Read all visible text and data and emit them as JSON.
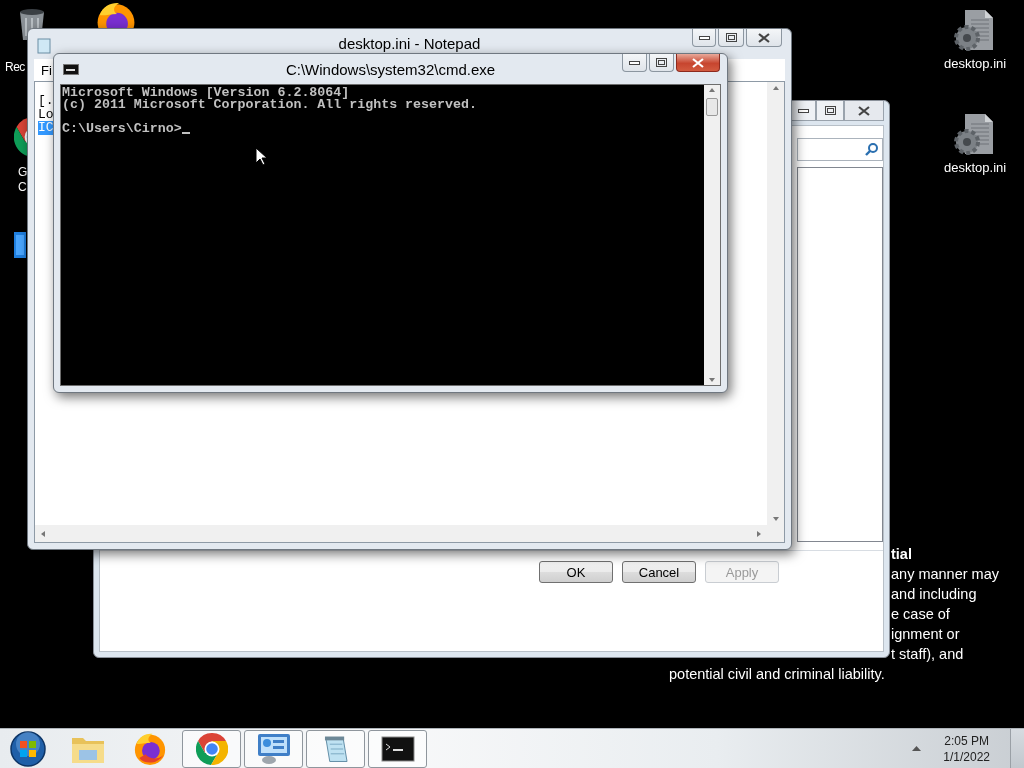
{
  "desktop": {
    "left_icons": [
      {
        "kind": "bin",
        "label_lines": [
          "Rec"
        ]
      },
      {
        "kind": "firefox"
      },
      {
        "kind": "chrome",
        "label_lines": [
          "G",
          "C"
        ]
      },
      {
        "kind": "blue"
      }
    ],
    "right_icons": [
      {
        "label": "desktop.ini"
      },
      {
        "label": "desktop.ini"
      }
    ],
    "notice": {
      "lines": [
        {
          "text": "tial",
          "bold": true
        },
        {
          "text": "any manner may",
          "bold": false
        },
        {
          "text": "and including",
          "bold": false
        },
        {
          "text": "e case of",
          "bold": false
        },
        {
          "text": "ignment or",
          "bold": false
        },
        {
          "text": "t staff), and",
          "bold": false
        }
      ],
      "last_line": "potential civil and criminal liability."
    }
  },
  "dialog": {
    "buttons": [
      {
        "label": "OK",
        "disabled": false
      },
      {
        "label": "Cancel",
        "disabled": false
      },
      {
        "label": "Apply",
        "disabled": true
      }
    ]
  },
  "notepad": {
    "title": "desktop.ini - Notepad",
    "menu": [
      "Fi"
    ],
    "lines": [
      {
        "text": "[.",
        "selected": false
      },
      {
        "text": "Lo",
        "selected": false
      },
      {
        "text": "IC",
        "selected": true
      }
    ]
  },
  "cmd": {
    "title": "C:\\Windows\\system32\\cmd.exe",
    "output": [
      "Microsoft Windows [Version 6.2.8064]",
      "(c) 2011 Microsoft Corporation. All rights reserved."
    ],
    "prompt": "C:\\Users\\Cirno>"
  },
  "taskbar": {
    "apps": [
      {
        "kind": "explorer",
        "running": false
      },
      {
        "kind": "firefox",
        "running": false
      },
      {
        "kind": "chrome",
        "running": true
      },
      {
        "kind": "control-panel",
        "running": true
      },
      {
        "kind": "notepad",
        "running": true
      },
      {
        "kind": "cmd",
        "running": true
      }
    ],
    "clock": {
      "time": "2:05 PM",
      "date": "1/1/2022"
    }
  }
}
